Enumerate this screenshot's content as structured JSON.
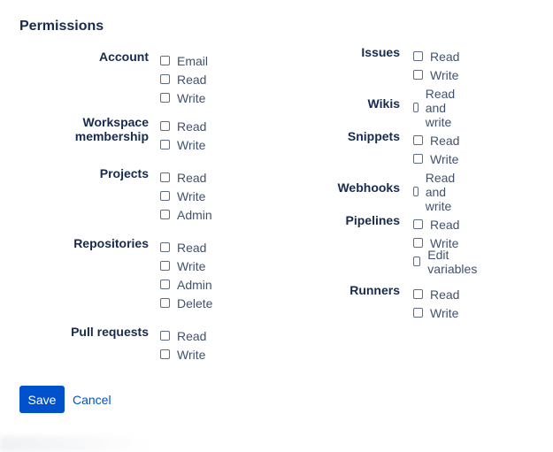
{
  "title": "Permissions",
  "left_groups": [
    {
      "label": [
        "Account"
      ],
      "options": [
        "Email",
        "Read",
        "Write"
      ]
    },
    {
      "label": [
        "Workspace",
        "membership"
      ],
      "options": [
        "Read",
        "Write"
      ]
    },
    {
      "label": [
        "Projects"
      ],
      "options": [
        "Read",
        "Write",
        "Admin"
      ]
    },
    {
      "label": [
        "Repositories"
      ],
      "options": [
        "Read",
        "Write",
        "Admin",
        "Delete"
      ]
    },
    {
      "label": [
        "Pull requests"
      ],
      "options": [
        "Read",
        "Write"
      ]
    }
  ],
  "right_groups": [
    {
      "label": [
        "Issues"
      ],
      "options": [
        "Read",
        "Write"
      ]
    },
    {
      "label": [
        "Wikis"
      ],
      "options": [
        "Read and write"
      ]
    },
    {
      "label": [
        "Snippets"
      ],
      "options": [
        "Read",
        "Write"
      ]
    },
    {
      "label": [
        "Webhooks"
      ],
      "options": [
        "Read and write"
      ]
    },
    {
      "label": [
        "Pipelines"
      ],
      "options": [
        "Read",
        "Write",
        "Edit variables"
      ]
    },
    {
      "label": [
        "Runners"
      ],
      "options": [
        "Read",
        "Write"
      ]
    }
  ],
  "actions": {
    "save_label": "Save",
    "cancel_label": "Cancel"
  }
}
